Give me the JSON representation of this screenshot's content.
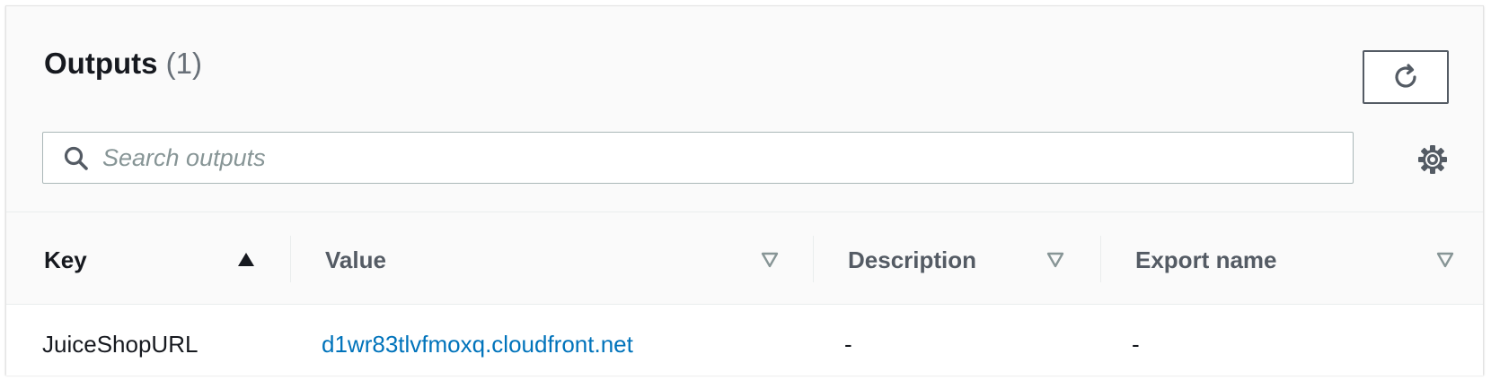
{
  "header": {
    "title": "Outputs",
    "count": "(1)",
    "refresh_icon": "refresh-icon",
    "settings_icon": "gear-icon"
  },
  "search": {
    "placeholder": "Search outputs",
    "value": "",
    "icon": "search-icon"
  },
  "table": {
    "columns": [
      {
        "label": "Key",
        "sort": "ascending"
      },
      {
        "label": "Value",
        "sort": "none"
      },
      {
        "label": "Description",
        "sort": "none"
      },
      {
        "label": "Export name",
        "sort": "none"
      }
    ],
    "rows": [
      {
        "key": "JuiceShopURL",
        "value": "d1wr83tlvfmoxq.cloudfront.net",
        "description": "-",
        "export_name": "-"
      }
    ]
  },
  "colors": {
    "link": "#0073bb",
    "text": "#16191f",
    "muted": "#687078",
    "header_bg": "#fafafa",
    "border": "#aab7b8"
  }
}
